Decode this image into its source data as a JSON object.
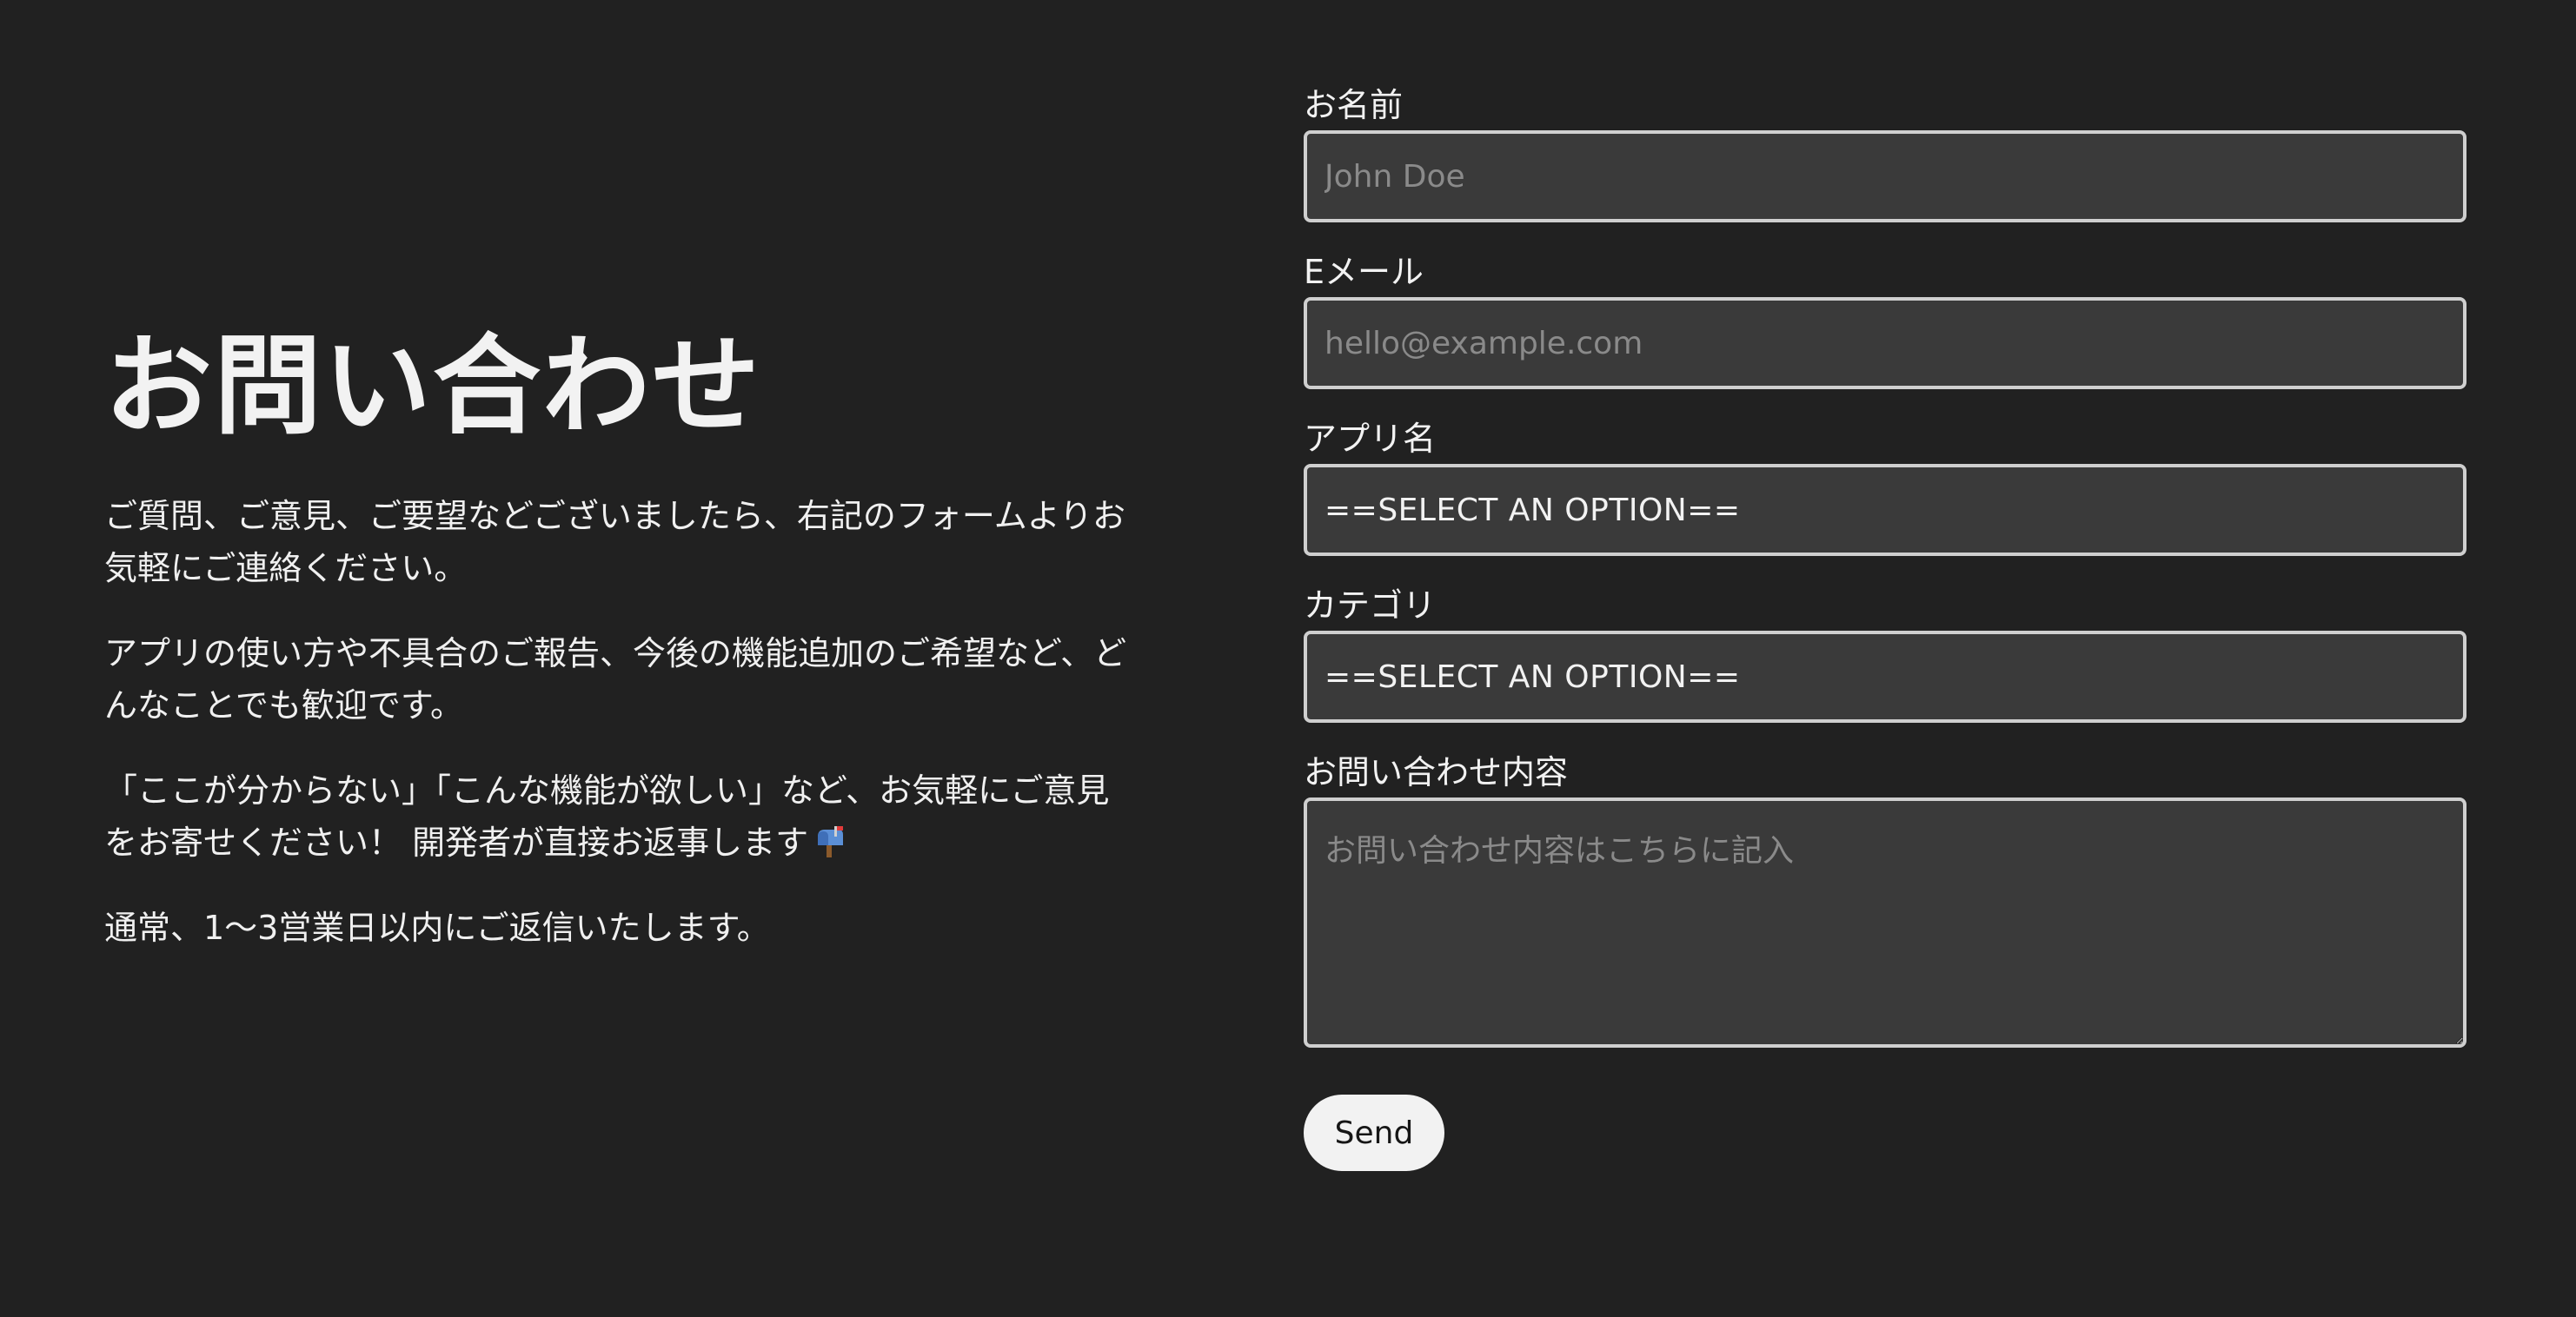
{
  "heading": "お問い合わせ",
  "intro": {
    "p1": "ご質問、ご意見、ご要望などございましたら、右記のフォームよりお気軽にご連絡ください。",
    "p2": "アプリの使い方や不具合のご報告、今後の機能追加のご希望など、どんなことでも歓迎です。",
    "p3": "「ここが分からない」「こんな機能が欲しい」など、お気軽にご意見をお寄せください！ 開発者が直接お返事します",
    "p3_icon": "mailbox-icon",
    "p4": "通常、1〜3営業日以内にご返信いたします。"
  },
  "form": {
    "name": {
      "label": "お名前",
      "placeholder": "John Doe"
    },
    "email": {
      "label": "Eメール",
      "placeholder": "hello@example.com"
    },
    "app": {
      "label": "アプリ名",
      "value": "==SELECT AN OPTION=="
    },
    "category": {
      "label": "カテゴリ",
      "value": "==SELECT AN OPTION=="
    },
    "message": {
      "label": "お問い合わせ内容",
      "placeholder": "お問い合わせ内容はこちらに記入"
    },
    "submit_label": "Send"
  },
  "colors": {
    "background": "#212121",
    "input_background": "#3a3a3a",
    "input_border": "#cfcfcf",
    "button_background": "#f2f2f2"
  }
}
